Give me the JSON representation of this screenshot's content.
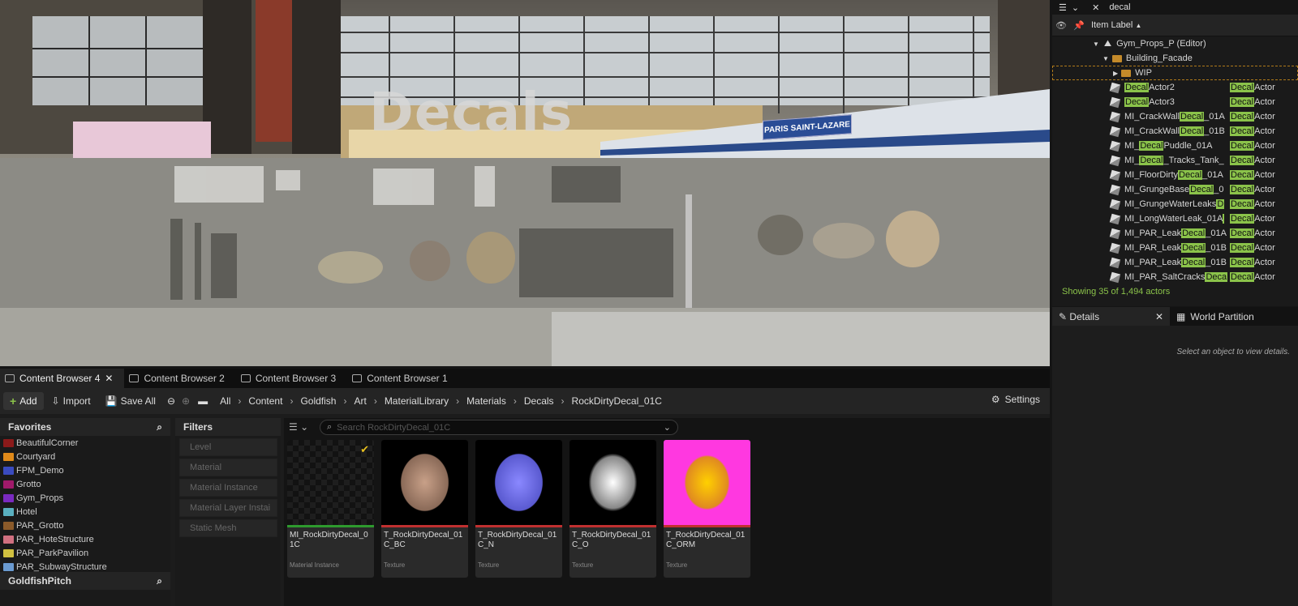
{
  "viewport": {
    "title_text": "Decals",
    "sign_text": "PARIS SAINT-LAZARE"
  },
  "outliner": {
    "search_value": "decal",
    "header_label": "Item Label",
    "sort_glyph": "▲",
    "root": "Gym_Props_P (Editor)",
    "folder1": "Building_Facade",
    "folder2": "WIP",
    "rows": [
      {
        "pre": "",
        "hl": "Decal",
        "post": "Actor2",
        "type_hl": "Decal",
        "type_post": "Actor"
      },
      {
        "pre": "",
        "hl": "Decal",
        "post": "Actor3",
        "type_hl": "Decal",
        "type_post": "Actor"
      },
      {
        "pre": "MI_CrackWall",
        "hl": "Decal",
        "post": "_01A",
        "type_hl": "Decal",
        "type_post": "Actor"
      },
      {
        "pre": "MI_CrackWall",
        "hl": "Decal",
        "post": "_01B",
        "type_hl": "Decal",
        "type_post": "Actor"
      },
      {
        "pre": "MI_",
        "hl": "Decal",
        "post": "Puddle_01A",
        "type_hl": "Decal",
        "type_post": "Actor"
      },
      {
        "pre": "MI_",
        "hl": "Decal",
        "post": "_Tracks_Tank_",
        "type_hl": "Decal",
        "type_post": "Actor"
      },
      {
        "pre": "MI_FloorDirty",
        "hl": "Decal",
        "post": "_01A",
        "type_hl": "Decal",
        "type_post": "Actor"
      },
      {
        "pre": "MI_GrungeBase",
        "hl": "Decal",
        "post": "_0",
        "type_hl": "Decal",
        "type_post": "Actor"
      },
      {
        "pre": "MI_GrungeWaterLeaks",
        "hl": "D",
        "post": "",
        "type_hl": "Decal",
        "type_post": "Actor"
      },
      {
        "pre": "MI_LongWaterLeak_01A",
        "hl": "",
        "post": "",
        "type_hl": "Decal",
        "type_post": "Actor"
      },
      {
        "pre": "MI_PAR_Leak",
        "hl": "Decal",
        "post": "_01A",
        "type_hl": "Decal",
        "type_post": "Actor"
      },
      {
        "pre": "MI_PAR_Leak",
        "hl": "Decal",
        "post": "_01B",
        "type_hl": "Decal",
        "type_post": "Actor"
      },
      {
        "pre": "MI_PAR_Leak",
        "hl": "Decal",
        "post": "_01B",
        "type_hl": "Decal",
        "type_post": "Actor"
      },
      {
        "pre": "MI_PAR_SaltCracks",
        "hl": "Deca",
        "post": "",
        "type_hl": "Decal",
        "type_post": "Actor"
      }
    ],
    "count_text": "Showing 35 of 1,494 actors"
  },
  "details": {
    "tab1": "Details",
    "tab2": "World Partition",
    "empty_text": "Select an object to view details."
  },
  "content_browser": {
    "tabs": [
      "Content Browser 4",
      "Content Browser 2",
      "Content Browser 3",
      "Content Browser 1"
    ],
    "add_label": "Add",
    "import_label": "Import",
    "save_all_label": "Save All",
    "breadcrumbs": [
      "All",
      "Content",
      "Goldfish",
      "Art",
      "MaterialLibrary",
      "Materials",
      "Decals",
      "RockDirtyDecal_01C"
    ],
    "settings_label": "Settings",
    "favorites_label": "Favorites",
    "favorites": [
      {
        "name": "BeautifulCorner",
        "color": "#8b1a1a"
      },
      {
        "name": "Courtyard",
        "color": "#e08a1a"
      },
      {
        "name": "FPM_Demo",
        "color": "#3a4bbf"
      },
      {
        "name": "Grotto",
        "color": "#a01a6a"
      },
      {
        "name": "Gym_Props",
        "color": "#7a2ac0"
      },
      {
        "name": "Hotel",
        "color": "#5ab0c0"
      },
      {
        "name": "PAR_Grotto",
        "color": "#8a5a2a"
      },
      {
        "name": "PAR_HoteStructure",
        "color": "#d07080"
      },
      {
        "name": "PAR_ParkPavilion",
        "color": "#d0c040"
      },
      {
        "name": "PAR_SubwayStructure",
        "color": "#6a9ad0"
      }
    ],
    "project_label": "GoldfishPitch",
    "filters_label": "Filters",
    "filters": [
      "Level",
      "Material",
      "Material Instance",
      "Material Layer Instai",
      "Static Mesh"
    ],
    "search_placeholder": "Search RockDirtyDecal_01C",
    "assets": [
      {
        "name": "MI_RockDirtyDecal_01C",
        "type": "Material Instance",
        "bar": "#2e9a2e"
      },
      {
        "name": "T_RockDirtyDecal_01C_BC",
        "type": "Texture",
        "bar": "#c03030"
      },
      {
        "name": "T_RockDirtyDecal_01C_N",
        "type": "Texture",
        "bar": "#c03030"
      },
      {
        "name": "T_RockDirtyDecal_01C_O",
        "type": "Texture",
        "bar": "#c03030"
      },
      {
        "name": "T_RockDirtyDecal_01C_ORM",
        "type": "Texture",
        "bar": "#c03030"
      }
    ]
  }
}
